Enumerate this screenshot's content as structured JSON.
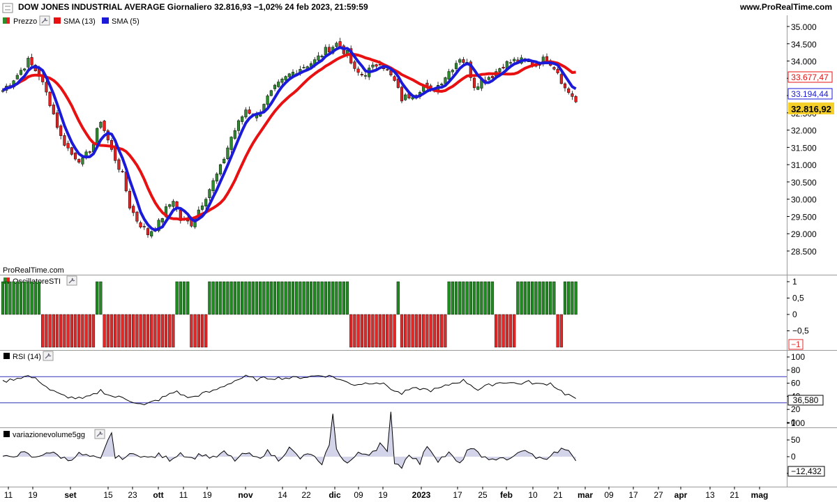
{
  "header": {
    "title": "DOW JONES INDUSTRIAL AVERAGE Giornaliero 32.816,93 −1,02% 24 feb 2023, 21:59:59",
    "site": "www.ProRealTime.com",
    "watermark": "ProRealTime.com"
  },
  "legend_price": [
    {
      "label": "Prezzo",
      "color": "#2e8b2e",
      "color2": "#e82020"
    },
    {
      "label": "SMA (13)",
      "color": "#e81010"
    },
    {
      "label": "SMA (5)",
      "color": "#1a1ad8"
    }
  ],
  "indicators": {
    "sti_label": "OscillatoreSTI",
    "rsi_label": "RSI (14)",
    "vol_label": "variazionevolume5gg"
  },
  "badges": {
    "sma13": "33.677,47",
    "sma5": "33.194,44",
    "last": "32.816,92",
    "sti": "−1",
    "rsi": "36,580",
    "vol": "−12,432"
  },
  "x_axis": {
    "labels": [
      {
        "text": "11",
        "bold": false
      },
      {
        "text": "19",
        "bold": false
      },
      {
        "text": "set",
        "bold": true
      },
      {
        "text": "15",
        "bold": false
      },
      {
        "text": "23",
        "bold": false
      },
      {
        "text": "ott",
        "bold": true
      },
      {
        "text": "11",
        "bold": false
      },
      {
        "text": "19",
        "bold": false
      },
      {
        "text": "nov",
        "bold": true
      },
      {
        "text": "14",
        "bold": false
      },
      {
        "text": "22",
        "bold": false
      },
      {
        "text": "dic",
        "bold": true
      },
      {
        "text": "09",
        "bold": false
      },
      {
        "text": "19",
        "bold": false
      },
      {
        "text": "2023",
        "bold": true
      },
      {
        "text": "17",
        "bold": false
      },
      {
        "text": "25",
        "bold": false
      },
      {
        "text": "feb",
        "bold": true
      },
      {
        "text": "10",
        "bold": false
      },
      {
        "text": "21",
        "bold": false
      },
      {
        "text": "mar",
        "bold": true
      },
      {
        "text": "09",
        "bold": false
      },
      {
        "text": "17",
        "bold": false
      },
      {
        "text": "27",
        "bold": false
      },
      {
        "text": "apr",
        "bold": true
      },
      {
        "text": "13",
        "bold": false
      },
      {
        "text": "21",
        "bold": false
      },
      {
        "text": "mag",
        "bold": true
      }
    ]
  },
  "chart_data": [
    {
      "type": "candlestick",
      "panel": "price",
      "y_ticks": [
        "35.000",
        "34.500",
        "34.000",
        "33.500",
        "33.000",
        "32.500",
        "32.000",
        "31.500",
        "31.000",
        "30.500",
        "30.000",
        "29.500",
        "29.000",
        "28.500"
      ],
      "ylim": [
        28300,
        35300
      ],
      "grid": false,
      "close_keypoints": [
        [
          0,
          33150
        ],
        [
          4,
          33600
        ],
        [
          7,
          34000
        ],
        [
          10,
          33600
        ],
        [
          13,
          32800
        ],
        [
          16,
          31800
        ],
        [
          19,
          31300
        ],
        [
          22,
          31100
        ],
        [
          25,
          31600
        ],
        [
          27,
          32300
        ],
        [
          30,
          31400
        ],
        [
          33,
          30700
        ],
        [
          35,
          29800
        ],
        [
          37,
          29400
        ],
        [
          40,
          29000
        ],
        [
          43,
          29300
        ],
        [
          45,
          29700
        ],
        [
          47,
          30000
        ],
        [
          49,
          29400
        ],
        [
          52,
          29300
        ],
        [
          54,
          29700
        ],
        [
          57,
          30300
        ],
        [
          60,
          30900
        ],
        [
          63,
          31800
        ],
        [
          67,
          32600
        ],
        [
          70,
          32400
        ],
        [
          72,
          32800
        ],
        [
          75,
          33200
        ],
        [
          79,
          33600
        ],
        [
          82,
          33800
        ],
        [
          86,
          34000
        ],
        [
          89,
          34300
        ],
        [
          92,
          34500
        ],
        [
          95,
          34200
        ],
        [
          97,
          33700
        ],
        [
          99,
          33600
        ],
        [
          102,
          33800
        ],
        [
          104,
          34000
        ],
        [
          106,
          33700
        ],
        [
          108,
          33400
        ],
        [
          110,
          32900
        ],
        [
          112,
          33000
        ],
        [
          114,
          33100
        ],
        [
          116,
          33300
        ],
        [
          118,
          33100
        ],
        [
          120,
          33300
        ],
        [
          123,
          33700
        ],
        [
          126,
          34100
        ],
        [
          128,
          33900
        ],
        [
          130,
          33300
        ],
        [
          133,
          33500
        ],
        [
          135,
          33600
        ],
        [
          138,
          33900
        ],
        [
          141,
          34000
        ],
        [
          144,
          34000
        ],
        [
          147,
          33900
        ],
        [
          150,
          34100
        ],
        [
          153,
          33700
        ],
        [
          155,
          33200
        ],
        [
          157,
          33000
        ],
        [
          158,
          32817
        ]
      ],
      "sma13_last": 33677.47,
      "sma5_last": 33194.44,
      "last_close": 32816.92,
      "colors": {
        "up": "#2e8b2e",
        "down": "#e82020",
        "sma13": "#e81010",
        "sma5": "#1a1ad8"
      }
    },
    {
      "type": "bar",
      "panel": "OscillatoreSTI",
      "y_ticks": [
        "1",
        "0,5",
        "0",
        "−0,5"
      ],
      "ylim": [
        -1.15,
        1.15
      ],
      "runs": [
        [
          1,
          11
        ],
        [
          -1,
          15
        ],
        [
          1,
          2
        ],
        [
          -1,
          20
        ],
        [
          1,
          4
        ],
        [
          -1,
          5
        ],
        [
          1,
          39
        ],
        [
          -1,
          13
        ],
        [
          1,
          1
        ],
        [
          -1,
          13
        ],
        [
          1,
          13
        ],
        [
          -1,
          6
        ],
        [
          1,
          11
        ],
        [
          -1,
          2
        ],
        [
          1,
          4
        ],
        [
          -1,
          5
        ]
      ],
      "colors": {
        "pos": "#1f8a1f",
        "neg": "#e02828"
      }
    },
    {
      "type": "line",
      "panel": "RSI (14)",
      "y_ticks": [
        "100",
        "80",
        "60",
        "40",
        "20",
        "0"
      ],
      "ylim": [
        0,
        100
      ],
      "bands": [
        70,
        30
      ],
      "keypoints": [
        [
          0,
          62
        ],
        [
          4,
          68
        ],
        [
          7,
          71
        ],
        [
          10,
          64
        ],
        [
          13,
          50
        ],
        [
          16,
          42
        ],
        [
          19,
          38
        ],
        [
          22,
          36
        ],
        [
          25,
          42
        ],
        [
          27,
          49
        ],
        [
          30,
          40
        ],
        [
          33,
          38
        ],
        [
          36,
          32
        ],
        [
          39,
          26
        ],
        [
          41,
          31
        ],
        [
          43,
          35
        ],
        [
          46,
          43
        ],
        [
          48,
          48
        ],
        [
          50,
          40
        ],
        [
          52,
          38
        ],
        [
          55,
          44
        ],
        [
          58,
          48
        ],
        [
          61,
          56
        ],
        [
          64,
          64
        ],
        [
          67,
          70
        ],
        [
          70,
          66
        ],
        [
          73,
          68
        ],
        [
          76,
          68
        ],
        [
          80,
          68
        ],
        [
          84,
          70
        ],
        [
          88,
          72
        ],
        [
          91,
          70
        ],
        [
          94,
          63
        ],
        [
          97,
          58
        ],
        [
          100,
          60
        ],
        [
          103,
          62
        ],
        [
          106,
          56
        ],
        [
          108,
          48
        ],
        [
          110,
          44
        ],
        [
          112,
          50
        ],
        [
          115,
          52
        ],
        [
          118,
          49
        ],
        [
          121,
          53
        ],
        [
          124,
          60
        ],
        [
          127,
          64
        ],
        [
          129,
          58
        ],
        [
          131,
          50
        ],
        [
          133,
          55
        ],
        [
          136,
          60
        ],
        [
          139,
          62
        ],
        [
          142,
          59
        ],
        [
          145,
          62
        ],
        [
          148,
          58
        ],
        [
          151,
          60
        ],
        [
          153,
          52
        ],
        [
          155,
          44
        ],
        [
          157,
          40
        ],
        [
          158,
          36.58
        ]
      ],
      "last": 36.58,
      "colors": {
        "line": "#000000",
        "band": "#3030b8"
      }
    },
    {
      "type": "area",
      "panel": "variazionevolume5gg",
      "y_ticks": [
        "100",
        "50",
        "0",
        "−50"
      ],
      "ylim": [
        -70,
        140
      ],
      "keypoints": [
        [
          0,
          -5
        ],
        [
          3,
          5
        ],
        [
          6,
          10
        ],
        [
          9,
          -5
        ],
        [
          12,
          15
        ],
        [
          15,
          5
        ],
        [
          18,
          -10
        ],
        [
          21,
          8
        ],
        [
          24,
          0
        ],
        [
          27,
          -10
        ],
        [
          30,
          75
        ],
        [
          31,
          -5
        ],
        [
          34,
          0
        ],
        [
          37,
          10
        ],
        [
          40,
          -5
        ],
        [
          43,
          5
        ],
        [
          46,
          -8
        ],
        [
          49,
          12
        ],
        [
          52,
          -5
        ],
        [
          55,
          8
        ],
        [
          58,
          -5
        ],
        [
          61,
          12
        ],
        [
          64,
          -10
        ],
        [
          67,
          10
        ],
        [
          70,
          -5
        ],
        [
          73,
          15
        ],
        [
          76,
          -8
        ],
        [
          79,
          25
        ],
        [
          82,
          -5
        ],
        [
          85,
          10
        ],
        [
          88,
          -30
        ],
        [
          90,
          40
        ],
        [
          91,
          125
        ],
        [
          92,
          20
        ],
        [
          95,
          -20
        ],
        [
          98,
          8
        ],
        [
          101,
          10
        ],
        [
          103,
          25
        ],
        [
          104,
          40
        ],
        [
          106,
          10
        ],
        [
          107,
          130
        ],
        [
          108,
          -15
        ],
        [
          110,
          -30
        ],
        [
          112,
          10
        ],
        [
          115,
          -20
        ],
        [
          117,
          35
        ],
        [
          120,
          -10
        ],
        [
          123,
          10
        ],
        [
          126,
          -25
        ],
        [
          128,
          20
        ],
        [
          131,
          15
        ],
        [
          134,
          -15
        ],
        [
          137,
          0
        ],
        [
          140,
          -10
        ],
        [
          143,
          20
        ],
        [
          146,
          5
        ],
        [
          149,
          -10
        ],
        [
          152,
          10
        ],
        [
          155,
          25
        ],
        [
          158,
          -12.432
        ]
      ],
      "last": -12.432,
      "colors": {
        "line": "#000000",
        "fill": "#d3d3ea"
      }
    }
  ]
}
